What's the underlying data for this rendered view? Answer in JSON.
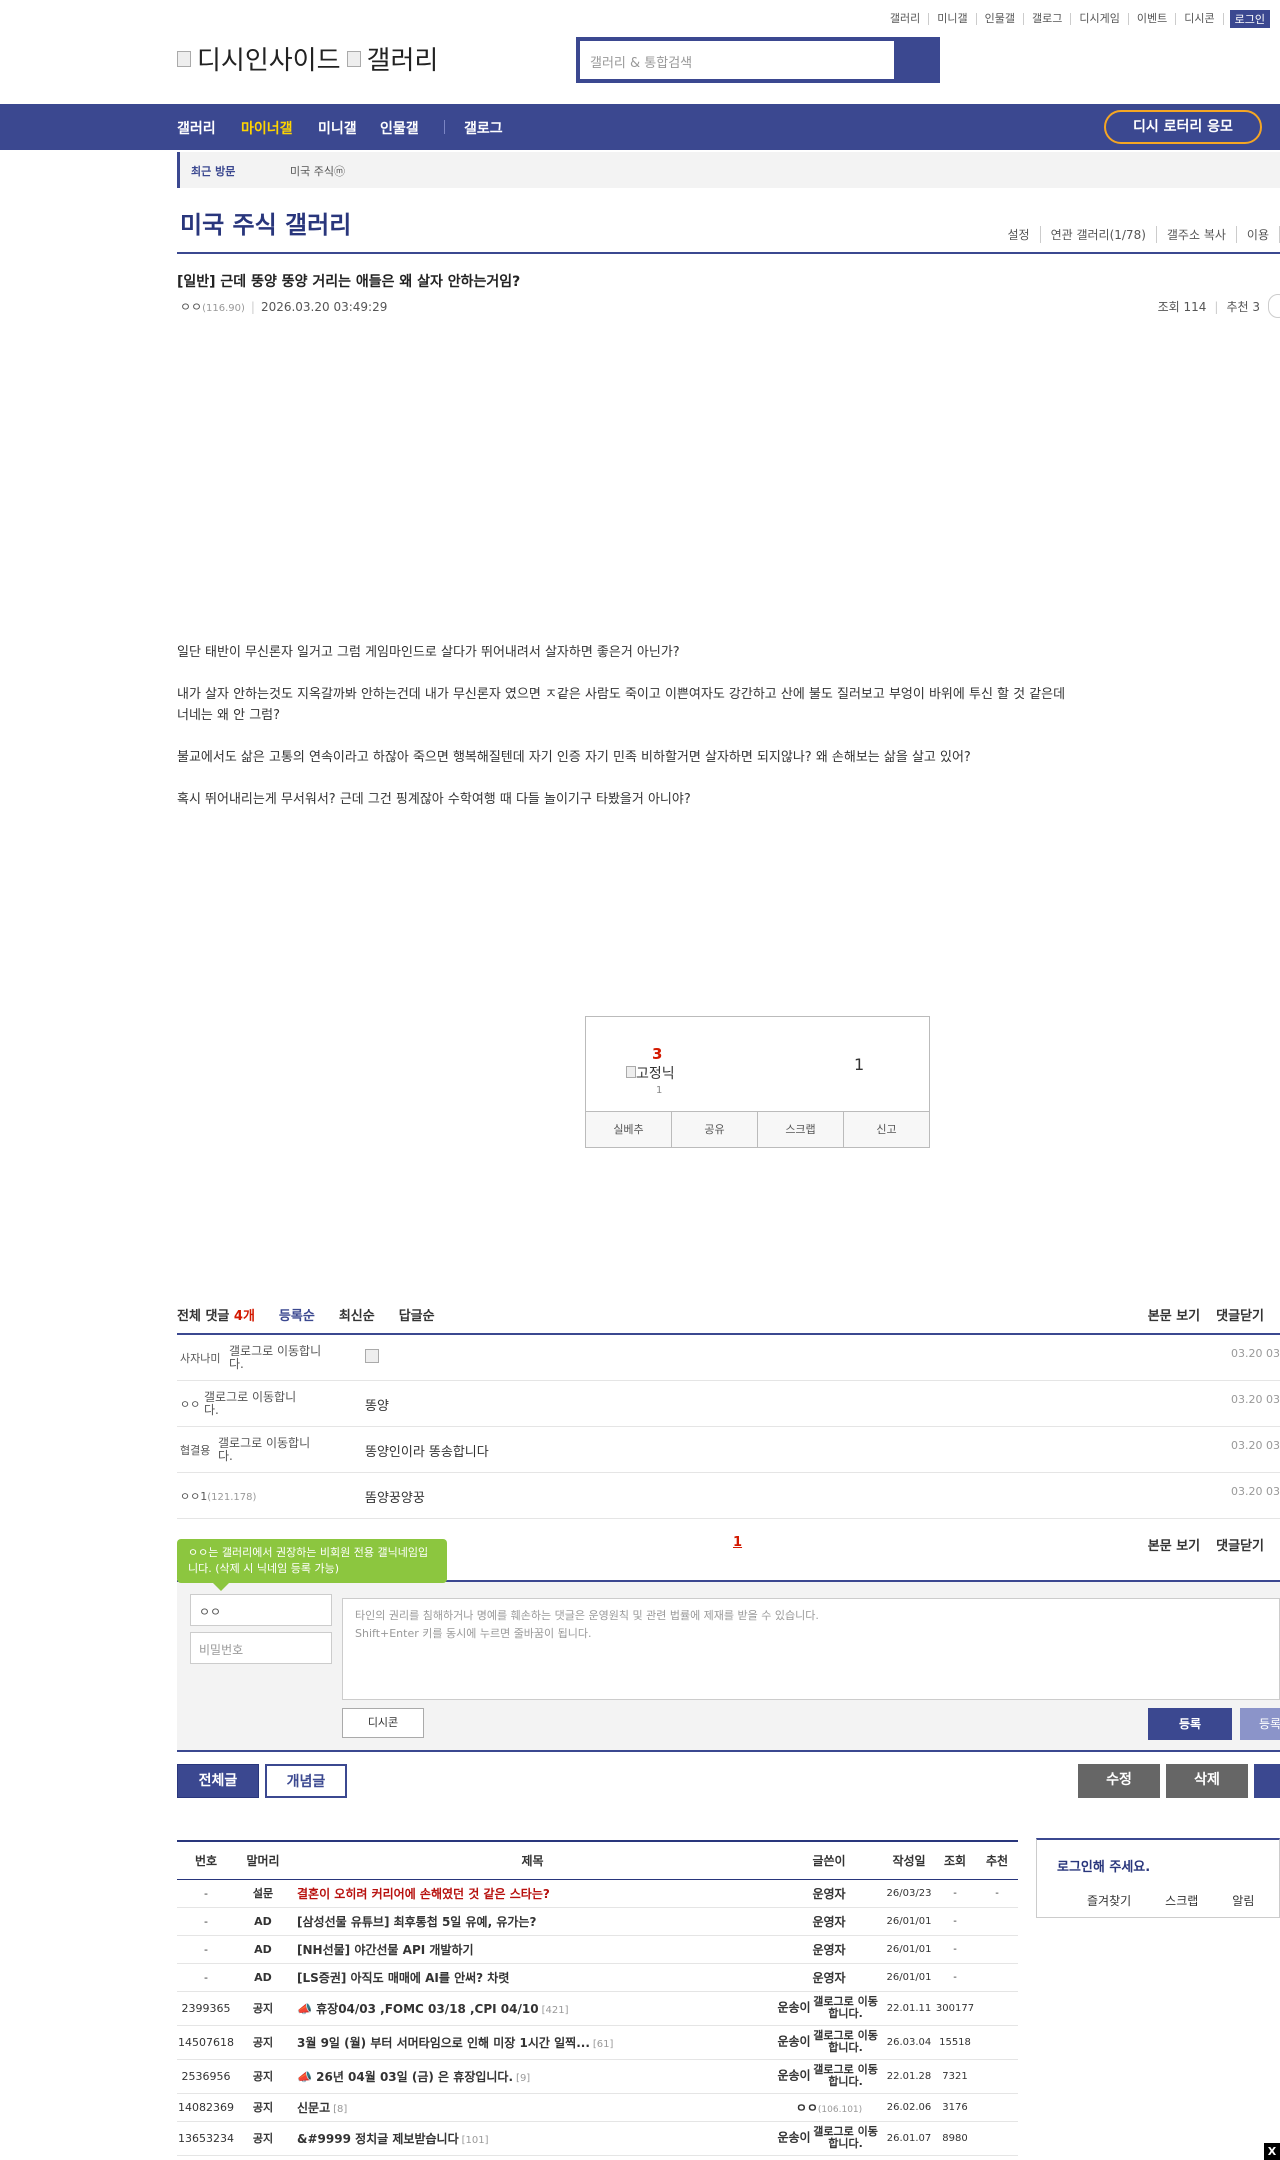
{
  "top_links": [
    "갤러리",
    "미니갤",
    "인물갤",
    "갤로그",
    "디시게임",
    "이벤트",
    "디시콘"
  ],
  "login_label": "로그인",
  "logo": {
    "site": "디시인사이드",
    "section": "갤러리"
  },
  "search": {
    "placeholder": "갤러리 & 통합검색"
  },
  "nav": {
    "items": [
      "갤러리",
      "마이너갤",
      "미니갤",
      "인물갤",
      "갤로그"
    ],
    "lottery": "디시 로터리 응모"
  },
  "recent": {
    "label": "최근 방문",
    "item": "미국 주식ⓜ"
  },
  "gallery": {
    "title": "미국 주식 갤러리",
    "tools": [
      "설정",
      "연관 갤러리(1/78)",
      "갤주소 복사",
      "이용"
    ]
  },
  "post": {
    "title": "[일반] 근데 뚱양 뚱양 거리는 애들은 왜 살자 안하는거임?",
    "author": "ㅇㅇ",
    "ip": "(116.90)",
    "date": "2026.03.20 03:49:29",
    "views_label": "조회 114",
    "recommend_label": "추천 3",
    "paragraphs": [
      "일단 태반이 무신론자 일거고 그럼 게임마인드로 살다가 뛰어내려서 살자하면 좋은거 아닌가?",
      "내가 살자 안하는것도 지옥갈까봐 안하는건데 내가 무신론자 였으면 ㅈ같은 사람도 죽이고 이쁜여자도 강간하고 산에 불도 질러보고 부엉이 바위에 투신 할 것 같은데 너네는 왜 안 그럼?",
      "불교에서도 삶은 고통의 연속이라고 하잖아 죽으면 행복해질텐데 자기 인증 자기 민족 비하할거면 살자하면 되지않나? 왜 손해보는 삶을 살고 있어?",
      "혹시 뛰어내리는게 무서워서? 근데 그건 핑계잖아 수학여행 때 다들 놀이기구 타봤을거 아니야?"
    ],
    "recommend": {
      "up": "3",
      "fixed_label": "고정닉",
      "fixed_count": "1",
      "down": "1"
    },
    "actions": [
      "실베추",
      "공유",
      "스크랩",
      "신고"
    ]
  },
  "comments": {
    "tab_all": "전체 댓글",
    "count": "4개",
    "sorts": [
      "등록순",
      "최신순",
      "답글순"
    ],
    "right_links": [
      "본문 보기",
      "댓글닫기"
    ],
    "items": [
      {
        "nick": "사자나미",
        "ip": "",
        "gallog": "갤로그로 이동합니다.",
        "memo": "",
        "date": "03.20 03"
      },
      {
        "nick": "ㅇㅇ",
        "ip": "",
        "gallog": "갤로그로 이동합니다.",
        "memo": "똥양",
        "date": "03.20 03"
      },
      {
        "nick": "협결용",
        "ip": "",
        "gallog": "갤로그로 이동합니다.",
        "memo": "똥양인이라 똥송합니다",
        "date": "03.20 03"
      },
      {
        "nick": "ㅇㅇ1",
        "ip": "(121.178)",
        "gallog": "",
        "memo": "똠양꿍양꿍",
        "date": "03.20 03"
      }
    ],
    "page": "1"
  },
  "write": {
    "tooltip": "ㅇㅇ는 갤러리에서 권장하는 비회원 전용 갤닉네임입니다. (삭제 시 닉네임 등록 가능)",
    "nick_value": "ㅇㅇ",
    "password_placeholder": "비밀번호",
    "textarea_line1": "타인의 권리를 침해하거나 명예를 훼손하는 댓글은 운영원칙 및 관련 법률에 제재를 받을 수 있습니다.",
    "textarea_line2": "Shift+Enter 키를 동시에 누르면 줄바꿈이 됩니다.",
    "dcon": "디시콘",
    "submit": "등록",
    "submit2": "등록"
  },
  "buttons": {
    "all": "전체글",
    "concept": "개념글",
    "modify": "수정",
    "delete": "삭제"
  },
  "list": {
    "headers": [
      "번호",
      "말머리",
      "제목",
      "글쓴이",
      "작성일",
      "조회",
      "추천"
    ],
    "rows": [
      {
        "num": "-",
        "head": "설문",
        "title": "결혼이 오히려 커리어에 손해였던 것 같은 스타는?",
        "replies": "",
        "writer": "운영자",
        "date": "26/03/23",
        "views": "-",
        "rec": "-",
        "red": true
      },
      {
        "num": "-",
        "head": "AD",
        "title": "[삼성선물 유튜브] 최후통첩 5일 유예, 유가는?",
        "replies": "",
        "writer": "운영자",
        "date": "26/01/01",
        "views": "-",
        "rec": "",
        "red": false
      },
      {
        "num": "-",
        "head": "AD",
        "title": "[NH선물] 야간선물 API 개발하기",
        "replies": "",
        "writer": "운영자",
        "date": "26/01/01",
        "views": "-",
        "rec": "",
        "red": false
      },
      {
        "num": "-",
        "head": "AD",
        "title": "[LS증권] 아직도 매매에 AI를 안써? 차렷",
        "replies": "",
        "writer": "운영자",
        "date": "26/01/01",
        "views": "-",
        "rec": "",
        "red": false
      },
      {
        "num": "2399365",
        "head": "공지",
        "title": "📣 휴장04/03 ,FOMC 03/18 ,CPI 04/10",
        "replies": "[421]",
        "writer": "운송이",
        "gallog": "갤로그로 이동합니다.",
        "date": "22.01.11",
        "views": "300177",
        "rec": "",
        "red": false
      },
      {
        "num": "14507618",
        "head": "공지",
        "title": "3월 9일 (월) 부터 서머타임으로 인해 미장 1시간 일찍...",
        "replies": "[61]",
        "writer": "운송이",
        "gallog": "갤로그로 이동합니다.",
        "date": "26.03.04",
        "views": "15518",
        "rec": "",
        "red": false
      },
      {
        "num": "2536956",
        "head": "공지",
        "title": "📣 26년 04월 03일 (금) 은 휴장입니다.",
        "replies": "[9]",
        "writer": "운송이",
        "gallog": "갤로그로 이동합니다.",
        "date": "22.01.28",
        "views": "7321",
        "rec": "",
        "red": false
      },
      {
        "num": "14082369",
        "head": "공지",
        "title": "신문고",
        "replies": "[8]",
        "writer": "ㅇㅇ",
        "ip": "(106.101)",
        "date": "26.02.06",
        "views": "3176",
        "rec": "",
        "red": false
      },
      {
        "num": "13653234",
        "head": "공지",
        "title": "&#9999 정치글 제보받습니다",
        "replies": "[101]",
        "writer": "운송이",
        "gallog": "갤로그로 이동합니다.",
        "date": "26.01.07",
        "views": "8980",
        "rec": "",
        "red": false
      }
    ]
  },
  "sidebox": {
    "title": "로그인해 주세요.",
    "tabs": [
      "즐겨찾기",
      "스크랩",
      "알림"
    ]
  },
  "close_label": "X",
  "colors": {
    "brand": "#3b4890",
    "accent": "#ffd400",
    "alert": "#d31900"
  }
}
